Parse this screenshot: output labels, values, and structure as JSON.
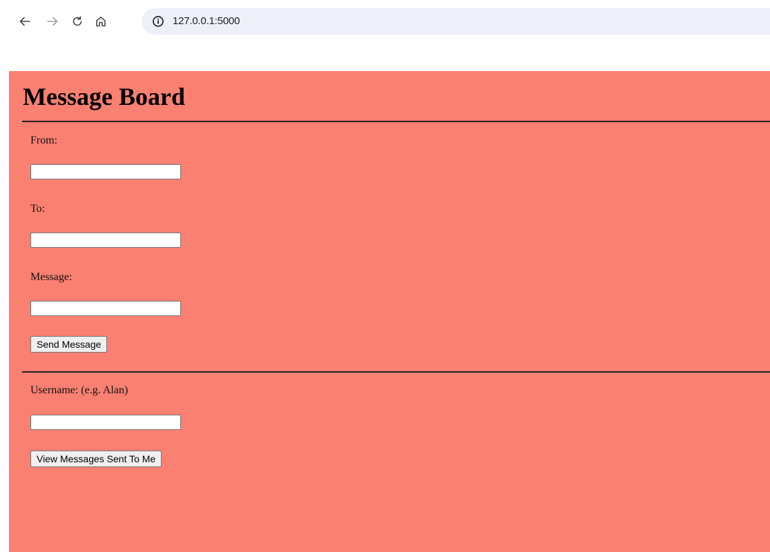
{
  "browser": {
    "url": "127.0.0.1:5000",
    "icons": {
      "back": "arrow-left-icon",
      "forward": "arrow-right-icon",
      "reload": "reload-icon",
      "home": "home-icon",
      "site_info": "info-icon"
    }
  },
  "page": {
    "background_color": "#fa8072",
    "title": "Message Board",
    "send_form": {
      "from_label": "From:",
      "from_value": "",
      "to_label": "To:",
      "to_value": "",
      "message_label": "Message:",
      "message_value": "",
      "submit_label": "Send Message"
    },
    "view_form": {
      "username_label": "Username: (e.g. Alan)",
      "username_value": "",
      "submit_label": "View Messages Sent To Me"
    }
  }
}
